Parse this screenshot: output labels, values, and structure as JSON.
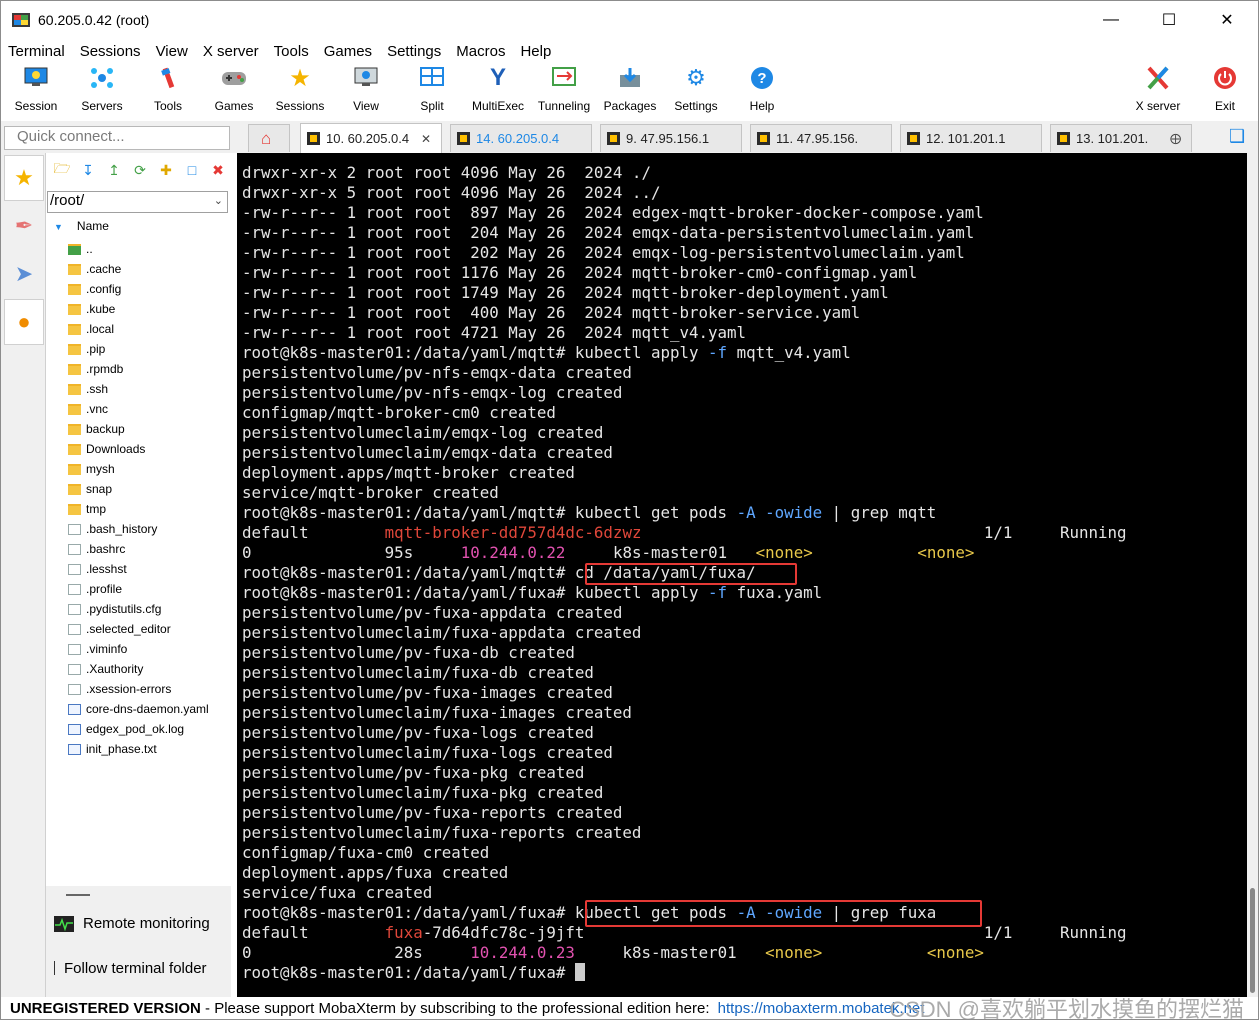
{
  "window": {
    "title": "60.205.0.42 (root)"
  },
  "menu": [
    "Terminal",
    "Sessions",
    "View",
    "X server",
    "Tools",
    "Games",
    "Settings",
    "Macros",
    "Help"
  ],
  "toolbar": {
    "session": "Session",
    "servers": "Servers",
    "tools": "Tools",
    "games": "Games",
    "sessions": "Sessions",
    "view": "View",
    "split": "Split",
    "multiexec": "MultiExec",
    "tunneling": "Tunneling",
    "packages": "Packages",
    "settings": "Settings",
    "help": "Help",
    "xserver": "X server",
    "exit": "Exit"
  },
  "quick_connect": {
    "placeholder": "Quick connect..."
  },
  "tabs": [
    {
      "label": "10. 60.205.0.4"
    },
    {
      "label": "14. 60.205.0.4"
    },
    {
      "label": "9. 47.95.156.1"
    },
    {
      "label": "11. 47.95.156."
    },
    {
      "label": "12. 101.201.1"
    },
    {
      "label": "13. 101.201."
    }
  ],
  "sidebar": {
    "path": "/root/",
    "column": "Name",
    "files": [
      "..",
      ".cache",
      ".config",
      ".kube",
      ".local",
      ".pip",
      ".rpmdb",
      ".ssh",
      ".vnc",
      "backup",
      "Downloads",
      "mysh",
      "snap",
      "tmp",
      ".bash_history",
      ".bashrc",
      ".lesshst",
      ".profile",
      ".pydistutils.cfg",
      ".selected_editor",
      ".viminfo",
      ".Xauthority",
      ".xsession-errors",
      "core-dns-daemon.yaml",
      "edgex_pod_ok.log",
      "init_phase.txt"
    ],
    "remote_monitoring": "Remote monitoring",
    "follow_terminal": "Follow terminal folder"
  },
  "terminal": {
    "ls_lines": [
      "drwxr-xr-x 2 root root 4096 May 26  2024 ./",
      "drwxr-xr-x 5 root root 4096 May 26  2024 ../",
      "-rw-r--r-- 1 root root  897 May 26  2024 edgex-mqtt-broker-docker-compose.yaml",
      "-rw-r--r-- 1 root root  204 May 26  2024 emqx-data-persistentvolumeclaim.yaml",
      "-rw-r--r-- 1 root root  202 May 26  2024 emqx-log-persistentvolumeclaim.yaml",
      "-rw-r--r-- 1 root root 1176 May 26  2024 mqtt-broker-cm0-configmap.yaml",
      "-rw-r--r-- 1 root root 1749 May 26  2024 mqtt-broker-deployment.yaml",
      "-rw-r--r-- 1 root root  400 May 26  2024 mqtt-broker-service.yaml",
      "-rw-r--r-- 1 root root 4721 May 26  2024 mqtt_v4.yaml"
    ],
    "prompt_mqtt": "root@k8s-master01:/data/yaml/mqtt# ",
    "prompt_fuxa": "root@k8s-master01:/data/yaml/fuxa# ",
    "cmd1": {
      "a": "kubectl apply ",
      "f": "-f",
      "b": " mqtt_v4.yaml"
    },
    "out1": [
      "persistentvolume/pv-nfs-emqx-data created",
      "persistentvolume/pv-nfs-emqx-log created",
      "configmap/mqtt-broker-cm0 created",
      "persistentvolumeclaim/emqx-log created",
      "persistentvolumeclaim/emqx-data created",
      "deployment.apps/mqtt-broker created",
      "service/mqtt-broker created"
    ],
    "cmd2": {
      "a": "kubectl get pods ",
      "A": "-A",
      "o": " -owide",
      "b": " | grep mqtt"
    },
    "pod1": {
      "ns": "default",
      "name_hl": "mqtt",
      "name_rest": "-broker-dd757d4dc-6dzwz",
      "ready": "1/1",
      "status": "Running",
      "restarts": "0",
      "age": "95s",
      "ip": "10.244.0.22",
      "node": "k8s-master01",
      "none1": "<none>",
      "none2": "<none>"
    },
    "cmd3": "cd /data/yaml/fuxa/",
    "cmd4": {
      "a": "kubectl apply ",
      "f": "-f",
      "b": " fuxa.yaml"
    },
    "out2": [
      "persistentvolume/pv-fuxa-appdata created",
      "persistentvolumeclaim/fuxa-appdata created",
      "persistentvolume/pv-fuxa-db created",
      "persistentvolumeclaim/fuxa-db created",
      "persistentvolume/pv-fuxa-images created",
      "persistentvolumeclaim/fuxa-images created",
      "persistentvolume/pv-fuxa-logs created",
      "persistentvolumeclaim/fuxa-logs created",
      "persistentvolume/pv-fuxa-pkg created",
      "persistentvolumeclaim/fuxa-pkg created",
      "persistentvolume/pv-fuxa-reports created",
      "persistentvolumeclaim/fuxa-reports created",
      "configmap/fuxa-cm0 created",
      "deployment.apps/fuxa created",
      "service/fuxa created"
    ],
    "cmd5": {
      "a": "kubectl get pods ",
      "A": "-A",
      "o": " -owide",
      "b": " | grep fuxa"
    },
    "pod2": {
      "ns": "default",
      "name_hl": "fuxa",
      "name_rest": "-7d64dfc78c-j9jft",
      "ready": "1/1",
      "status": "Running",
      "restarts": "0",
      "age": "28s",
      "ip": "10.244.0.23",
      "node": "k8s-master01",
      "none1": "<none>",
      "none2": "<none>"
    }
  },
  "status": {
    "unregistered": "UNREGISTERED VERSION",
    "sep": " - ",
    "message": "Please support MobaXterm by subscribing to the professional edition here: ",
    "link": "https://mobaxterm.mobatek.net",
    "watermark": "CSDN @喜欢躺平划水摸鱼的摆烂猫"
  }
}
